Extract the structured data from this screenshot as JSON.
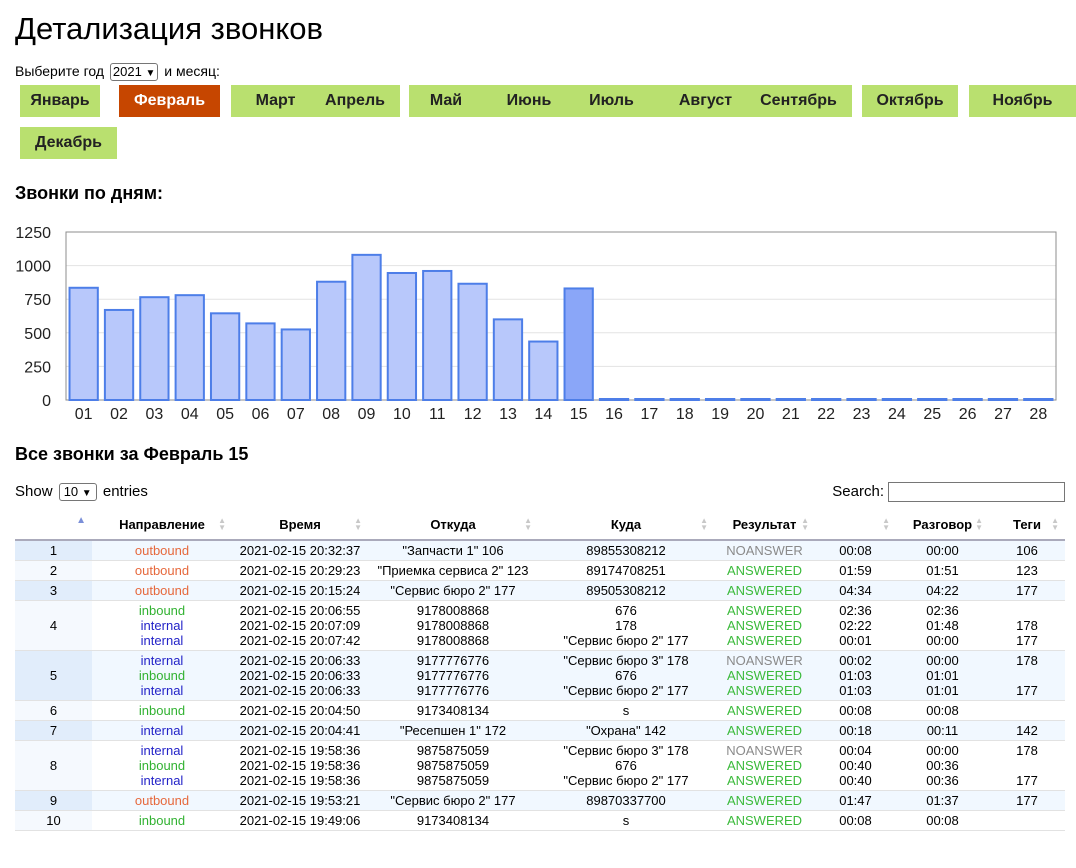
{
  "page": {
    "title": "Детализация звонков",
    "year_label": "Выберите год",
    "year_value": "2021",
    "month_label": "и месяц:"
  },
  "months": [
    {
      "label": "Январь"
    },
    {
      "label": "Февраль",
      "active": true
    },
    {
      "label": "Март"
    },
    {
      "label": "Апрель"
    },
    {
      "label": "Май"
    },
    {
      "label": "Июнь"
    },
    {
      "label": "Июль"
    },
    {
      "label": "Август"
    },
    {
      "label": "Сентябрь"
    },
    {
      "label": "Октябрь"
    },
    {
      "label": "Ноябрь"
    },
    {
      "label": "Декабрь"
    }
  ],
  "colors": {
    "month_bg": "#b9e06f",
    "month_active_bg": "#c64600",
    "bar_fill": "#b8c8fb",
    "bar_stroke": "#4d7ee8",
    "bar_selected_fill": "#8aa6f8",
    "outbound": "#e6693d",
    "inbound": "#32b232",
    "internal": "#2323c8",
    "answered": "#3bba3b",
    "noanswer": "#8a8a8a"
  },
  "chart_title": "Звонки по дням:",
  "chart_data": {
    "type": "bar",
    "categories": [
      "01",
      "02",
      "03",
      "04",
      "05",
      "06",
      "07",
      "08",
      "09",
      "10",
      "11",
      "12",
      "13",
      "14",
      "15",
      "16",
      "17",
      "18",
      "19",
      "20",
      "21",
      "22",
      "23",
      "24",
      "25",
      "26",
      "27",
      "28"
    ],
    "values": [
      835,
      670,
      765,
      780,
      645,
      570,
      525,
      880,
      1080,
      945,
      960,
      865,
      600,
      435,
      830,
      0,
      0,
      0,
      0,
      0,
      0,
      0,
      0,
      0,
      0,
      0,
      0,
      0
    ],
    "selected": "15",
    "y_ticks": [
      "0",
      "250",
      "500",
      "750",
      "1000",
      "1250"
    ],
    "ylim": [
      0,
      1250
    ],
    "grid": true
  },
  "table_title": "Все звонки за Февраль 15",
  "controls": {
    "show_label": "Show",
    "length_value": "10",
    "entries_label": "entries",
    "search_label": "Search:"
  },
  "table": {
    "headers": [
      "",
      "Направление",
      "Время",
      "Откуда",
      "Куда",
      "Результат",
      "",
      "Разговор",
      "Теги"
    ],
    "rows": [
      {
        "n": "1",
        "calls": [
          {
            "dir": "outbound",
            "time": "2021-02-15 20:32:37",
            "from": "\"Запчасти 1\" 106",
            "to": "89855308212",
            "res": "NOANSWER",
            "dur": "00:08",
            "talk": "00:00",
            "tag": "106"
          }
        ]
      },
      {
        "n": "2",
        "calls": [
          {
            "dir": "outbound",
            "time": "2021-02-15 20:29:23",
            "from": "\"Приемка сервиса 2\" 123",
            "to": "89174708251",
            "res": "ANSWERED",
            "dur": "01:59",
            "talk": "01:51",
            "tag": "123"
          }
        ]
      },
      {
        "n": "3",
        "calls": [
          {
            "dir": "outbound",
            "time": "2021-02-15 20:15:24",
            "from": "\"Сервис бюро 2\" 177",
            "to": "89505308212",
            "res": "ANSWERED",
            "dur": "04:34",
            "talk": "04:22",
            "tag": "177"
          }
        ]
      },
      {
        "n": "4",
        "calls": [
          {
            "dir": "inbound",
            "time": "2021-02-15 20:06:55",
            "from": "9178008868",
            "to": "676",
            "res": "ANSWERED",
            "dur": "02:36",
            "talk": "02:36",
            "tag": ""
          },
          {
            "dir": "internal",
            "time": "2021-02-15 20:07:09",
            "from": "9178008868",
            "to": "178",
            "res": "ANSWERED",
            "dur": "02:22",
            "talk": "01:48",
            "tag": "178"
          },
          {
            "dir": "internal",
            "time": "2021-02-15 20:07:42",
            "from": "9178008868",
            "to": "\"Сервис бюро 2\" 177",
            "res": "ANSWERED",
            "dur": "00:01",
            "talk": "00:00",
            "tag": "177"
          }
        ]
      },
      {
        "n": "5",
        "calls": [
          {
            "dir": "internal",
            "time": "2021-02-15 20:06:33",
            "from": "9177776776",
            "to": "\"Сервис бюро 3\" 178",
            "res": "NOANSWER",
            "dur": "00:02",
            "talk": "00:00",
            "tag": "178"
          },
          {
            "dir": "inbound",
            "time": "2021-02-15 20:06:33",
            "from": "9177776776",
            "to": "676",
            "res": "ANSWERED",
            "dur": "01:03",
            "talk": "01:01",
            "tag": ""
          },
          {
            "dir": "internal",
            "time": "2021-02-15 20:06:33",
            "from": "9177776776",
            "to": "\"Сервис бюро 2\" 177",
            "res": "ANSWERED",
            "dur": "01:03",
            "talk": "01:01",
            "tag": "177"
          }
        ]
      },
      {
        "n": "6",
        "calls": [
          {
            "dir": "inbound",
            "time": "2021-02-15 20:04:50",
            "from": "9173408134",
            "to": "s",
            "res": "ANSWERED",
            "dur": "00:08",
            "talk": "00:08",
            "tag": ""
          }
        ]
      },
      {
        "n": "7",
        "calls": [
          {
            "dir": "internal",
            "time": "2021-02-15 20:04:41",
            "from": "\"Ресепшен 1\" 172",
            "to": "\"Охрана\" 142",
            "res": "ANSWERED",
            "dur": "00:18",
            "talk": "00:11",
            "tag": "142"
          }
        ]
      },
      {
        "n": "8",
        "calls": [
          {
            "dir": "internal",
            "time": "2021-02-15 19:58:36",
            "from": "9875875059",
            "to": "\"Сервис бюро 3\" 178",
            "res": "NOANSWER",
            "dur": "00:04",
            "talk": "00:00",
            "tag": "178"
          },
          {
            "dir": "inbound",
            "time": "2021-02-15 19:58:36",
            "from": "9875875059",
            "to": "676",
            "res": "ANSWERED",
            "dur": "00:40",
            "talk": "00:36",
            "tag": ""
          },
          {
            "dir": "internal",
            "time": "2021-02-15 19:58:36",
            "from": "9875875059",
            "to": "\"Сервис бюро 2\" 177",
            "res": "ANSWERED",
            "dur": "00:40",
            "talk": "00:36",
            "tag": "177"
          }
        ]
      },
      {
        "n": "9",
        "calls": [
          {
            "dir": "outbound",
            "time": "2021-02-15 19:53:21",
            "from": "\"Сервис бюро 2\" 177",
            "to": "89870337700",
            "res": "ANSWERED",
            "dur": "01:47",
            "talk": "01:37",
            "tag": "177"
          }
        ]
      },
      {
        "n": "10",
        "calls": [
          {
            "dir": "inbound",
            "time": "2021-02-15 19:49:06",
            "from": "9173408134",
            "to": "s",
            "res": "ANSWERED",
            "dur": "00:08",
            "talk": "00:08",
            "tag": ""
          }
        ]
      }
    ]
  }
}
